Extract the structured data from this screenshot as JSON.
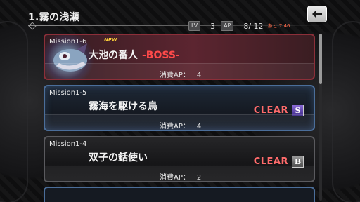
{
  "header": {
    "title": "1.霧の浅瀬"
  },
  "stats": {
    "lv_tag": "LV",
    "lv_value": "3",
    "ap_tag": "AP",
    "ap_value": "8/ 12",
    "ap_timer": "あと 7:46"
  },
  "back_button_icon": "back-arrow-icon",
  "missions": [
    {
      "id": "Mission1-6",
      "name": "大池の番人",
      "boss_suffix": "-BOSS-",
      "badge": "NEW",
      "ap_label": "消費AP：",
      "ap_cost": "4",
      "clear": "",
      "rank": ""
    },
    {
      "id": "Mission1-5",
      "name": "霧海を駆ける鳥",
      "ap_label": "消費AP：",
      "ap_cost": "4",
      "clear": "CLEAR",
      "rank": "S"
    },
    {
      "id": "Mission1-4",
      "name": "双子の銛使い",
      "ap_label": "消費AP：",
      "ap_cost": "2",
      "clear": "CLEAR",
      "rank": "B"
    }
  ],
  "colors": {
    "boss_red": "#ff4a4a",
    "clear_red": "#ff6b6b",
    "new_yellow": "#ffd23a",
    "rank_s": "#6a4fc0"
  },
  "scroll": {
    "position_fraction": 0.0
  }
}
